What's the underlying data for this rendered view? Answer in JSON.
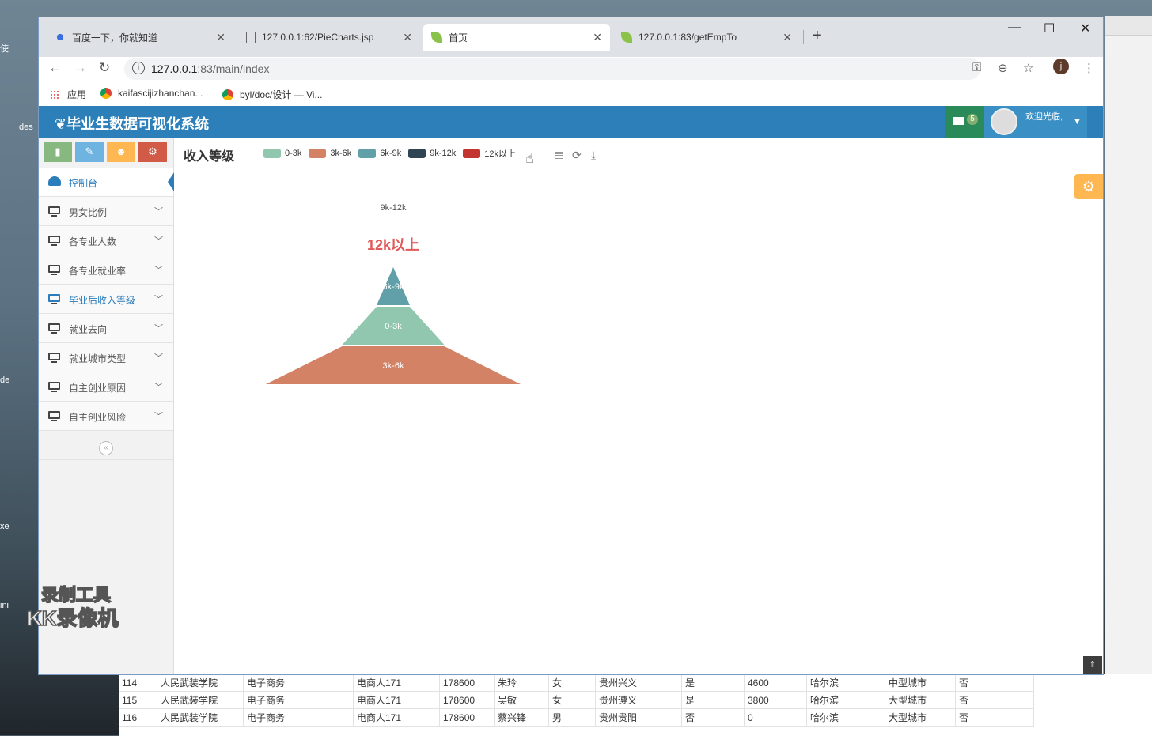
{
  "tabs": [
    {
      "title": "百度一下，你就知道",
      "icon": "baidu-paw-icon"
    },
    {
      "title": "127.0.0.1:62/PieCharts.jsp",
      "icon": "page-icon"
    },
    {
      "title": "首页",
      "icon": "leaf-icon"
    },
    {
      "title": "127.0.0.1:83/getEmpTo",
      "icon": "leaf-icon"
    }
  ],
  "address": {
    "host": "127.0.0.1",
    "rest": ":83/main/index"
  },
  "bookmarks": {
    "apps": "应用",
    "items": [
      "kaifascijizhanchan...",
      "byl/doc/设计 — Vi..."
    ]
  },
  "profile_initial": "j",
  "app": {
    "title": "毕业生数据可视化系统",
    "mail_count": "5",
    "welcome": "欢迎光临,"
  },
  "sidebar": {
    "items": [
      {
        "label": "控制台"
      },
      {
        "label": "男女比例"
      },
      {
        "label": "各专业人数"
      },
      {
        "label": "各专业就业率"
      },
      {
        "label": "毕业后收入等级"
      },
      {
        "label": "就业去向"
      },
      {
        "label": "就业城市类型"
      },
      {
        "label": "自主创业原因"
      },
      {
        "label": "自主创业风险"
      }
    ]
  },
  "chart_data": {
    "type": "funnel",
    "title": "收入等级",
    "legend": [
      "0-3k",
      "3k-6k",
      "6k-9k",
      "9k-12k",
      "12k以上"
    ],
    "colors": [
      "#91c7ae",
      "#d48265",
      "#61a0a8",
      "#2f4554",
      "#c23531"
    ],
    "sort": "ascending",
    "series": [
      {
        "name": "3k-6k",
        "value": 100
      },
      {
        "name": "0-3k",
        "value": 40
      },
      {
        "name": "6k-9k",
        "value": 13
      },
      {
        "name": "9k-12k",
        "value": 0
      },
      {
        "name": "12k以上",
        "value": 0
      }
    ],
    "emphasis_label": "12k以上",
    "legend_position": "top"
  },
  "background_sheet": {
    "rows": [
      [
        "114",
        "人民武装学院",
        "电子商务",
        "电商人171",
        "178600",
        "朱玲",
        "女",
        "贵州兴义",
        "是",
        "4600",
        "哈尔滨",
        "中型城市",
        "否"
      ],
      [
        "115",
        "人民武装学院",
        "电子商务",
        "电商人171",
        "178600",
        "吴敏",
        "女",
        "贵州遵义",
        "是",
        "3800",
        "哈尔滨",
        "大型城市",
        "否"
      ],
      [
        "116",
        "人民武装学院",
        "电子商务",
        "电商人171",
        "178600",
        "蔡兴锋",
        "男",
        "贵州贵阳",
        "否",
        "0",
        "哈尔滨",
        "大型城市",
        "否"
      ]
    ]
  },
  "watermark": {
    "line1": "录制工具",
    "line2": "KK录像机"
  }
}
